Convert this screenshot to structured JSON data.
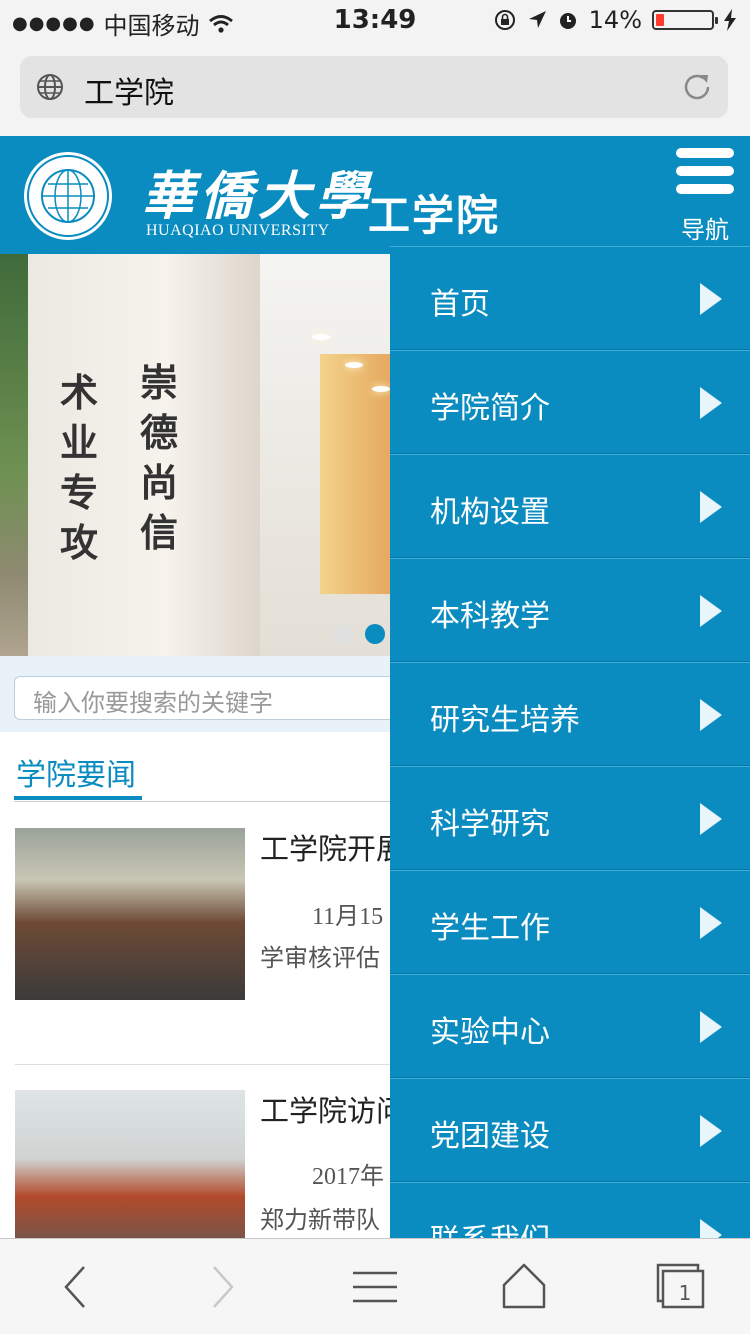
{
  "status_bar": {
    "carrier": "中国移动",
    "time": "13:49",
    "battery_percent": "14%",
    "battery_level": 0.14,
    "icons": [
      "signal-dots-icon",
      "wifi-icon",
      "orientation-lock-icon",
      "location-icon",
      "alarm-icon",
      "battery-icon",
      "charging-icon"
    ]
  },
  "address_bar": {
    "url": "工学院",
    "icons": [
      "globe-icon",
      "reload-icon"
    ]
  },
  "header": {
    "logo_calligraphy": "華僑大學",
    "logo_english": "HUAQIAO UNIVERSITY",
    "seal_text": "HUAQIAO UNIVERSITY",
    "college_name": "工学院",
    "nav_label": "导航",
    "accent_color": "#0a8cc0"
  },
  "banner": {
    "wall_text_col1": [
      "崇",
      "德",
      "尚",
      "信"
    ],
    "wall_text_col2": [
      "术",
      "业",
      "专",
      "攻"
    ],
    "slide_count": 2,
    "active_slide": 2
  },
  "search": {
    "placeholder": "输入你要搜索的关键字"
  },
  "news": {
    "section_title": "学院要闻",
    "items": [
      {
        "title": "工学院开展",
        "date": "11月15",
        "snippet": "学审核评估"
      },
      {
        "title": "工学院访问",
        "date": "2017年",
        "snippet": "郑力新带队"
      }
    ]
  },
  "nav_menu": {
    "items": [
      {
        "label": "首页"
      },
      {
        "label": "学院简介"
      },
      {
        "label": "机构设置"
      },
      {
        "label": "本科教学"
      },
      {
        "label": "研究生培养"
      },
      {
        "label": "科学研究"
      },
      {
        "label": "学生工作"
      },
      {
        "label": "实验中心"
      },
      {
        "label": "党团建设"
      },
      {
        "label": "联系我们"
      }
    ]
  },
  "toolbar": {
    "tab_count": "1",
    "icons": [
      "back-icon",
      "forward-icon",
      "menu-icon",
      "home-icon",
      "tabs-icon"
    ]
  }
}
